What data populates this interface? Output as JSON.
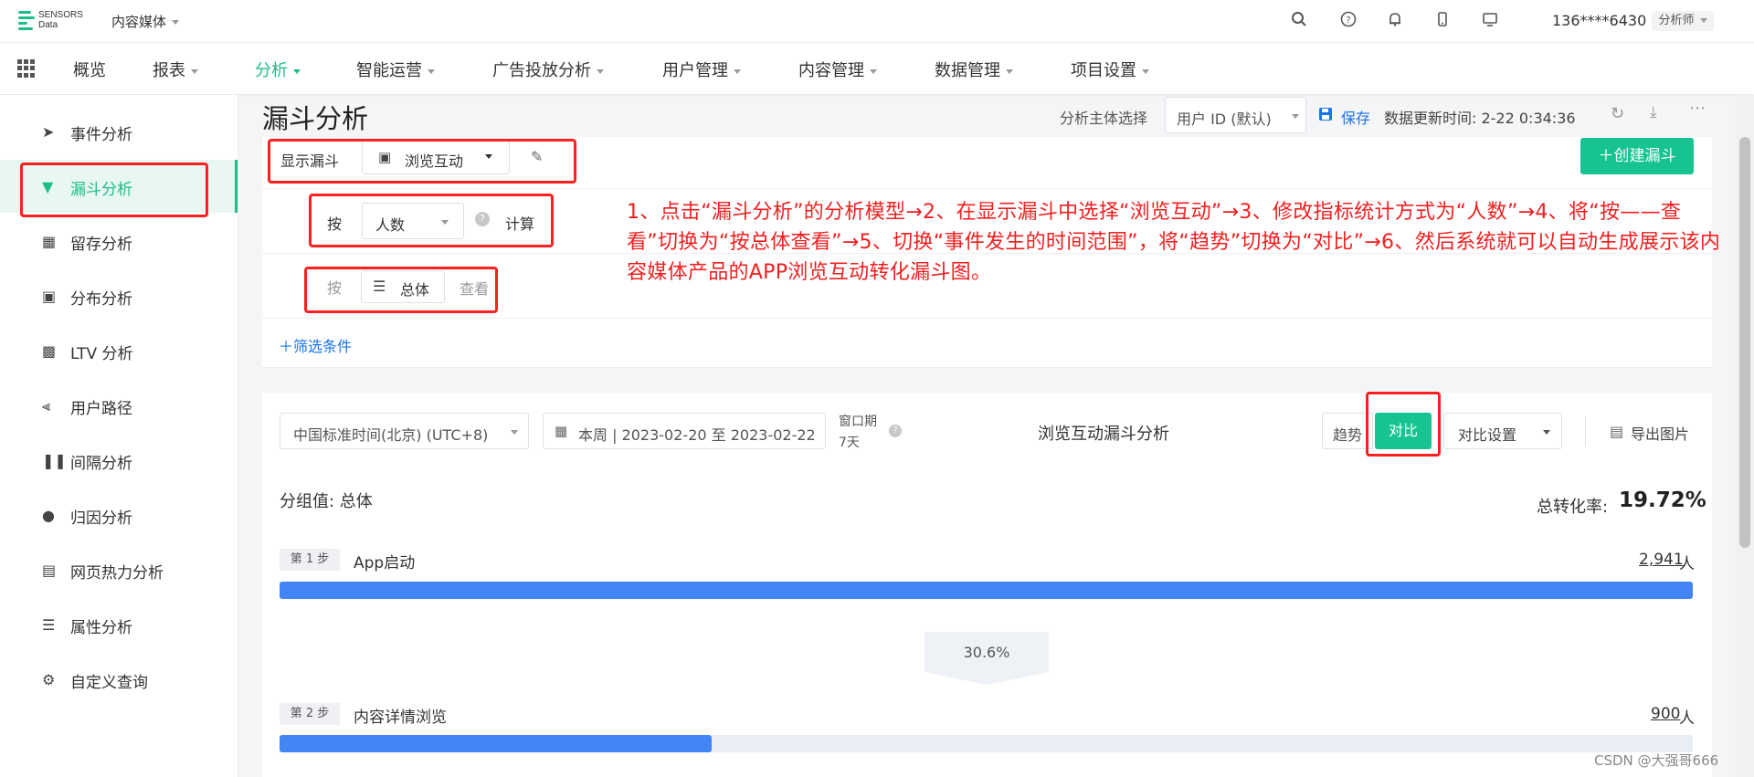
{
  "brand": {
    "line1": "SENSORS",
    "line2": "Data"
  },
  "project": "内容媒体",
  "user": {
    "phone": "136****6430",
    "role": "分析师"
  },
  "nav": [
    "概览",
    "报表",
    "分析",
    "智能运营",
    "广告投放分析",
    "用户管理",
    "内容管理",
    "数据管理",
    "项目设置"
  ],
  "sidebar": [
    "事件分析",
    "漏斗分析",
    "留存分析",
    "分布分析",
    "LTV 分析",
    "用户路径",
    "间隔分析",
    "归因分析",
    "网页热力分析",
    "属性分析",
    "自定义查询"
  ],
  "header": {
    "title": "漏斗分析",
    "subject_label": "分析主体选择",
    "subject_value": "用户 ID (默认)",
    "save": "保存",
    "update_time": "数据更新时间: 2-22 0:34:36"
  },
  "config": {
    "show_funnel_label": "显示漏斗",
    "funnel_name": "浏览互动",
    "create_btn": "创建漏斗",
    "by_label": "按",
    "metric": "人数",
    "calc_label": "计算",
    "by_label2": "按",
    "group_value": "总体",
    "view_label": "查看",
    "filter": "筛选条件"
  },
  "annotation": "1、点击“漏斗分析”的分析模型→2、在显示漏斗中选择“浏览互动”→3、修改指标统计方式为“人数”→4、将“按——查看”切换为“按总体查看”→5、切换“事件发生的时间范围”，将“趋势”切换为“对比”→6、然后系统就可以自动生成展示该内容媒体产品的APP浏览互动转化漏斗图。",
  "toolbar": {
    "timezone": "中国标准时间(北京) (UTC+8)",
    "date_range": "本周 | 2023-02-20 至 2023-02-22",
    "window_label": "窗口期",
    "window_value": "7天",
    "chart_title": "浏览互动漏斗分析",
    "trend": "趋势",
    "compare": "对比",
    "compare_settings": "对比设置",
    "export": "导出图片"
  },
  "result": {
    "group_label": "分组值: 总体",
    "total_label": "总转化率:",
    "total_value": "19.72%",
    "conversion": "30.6%",
    "steps": [
      {
        "tag": "第 1 步",
        "name": "App启动",
        "count": "2,941",
        "unit": "人",
        "fill": 1.0
      },
      {
        "tag": "第 2 步",
        "name": "内容详情浏览",
        "count": "900",
        "unit": "人",
        "fill": 0.306
      }
    ]
  },
  "watermark": "CSDN @大强哥666",
  "colors": {
    "accent": "#16c391",
    "bar": "#4285f4",
    "annotation": "#f01f1f"
  }
}
